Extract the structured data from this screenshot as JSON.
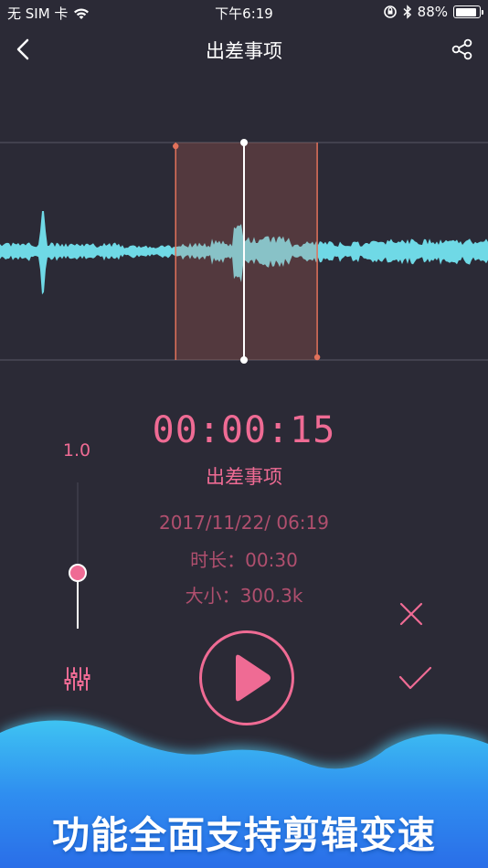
{
  "status_bar": {
    "carrier": "无 SIM 卡",
    "time": "下午6:19",
    "battery_text": "88%",
    "battery_level": 0.88
  },
  "nav": {
    "title": "出差事项",
    "back_icon": "chevron-left-icon",
    "share_icon": "share-icon"
  },
  "player": {
    "timer": "00:00:15",
    "name": "出差事项",
    "date": "2017/11/22/ 06:19",
    "duration": "时长：00:30",
    "size": "大小：300.3k"
  },
  "speed": {
    "value_label": "1.0",
    "level": 0.38
  },
  "selection": {
    "start_fraction": 0.36,
    "end_fraction": 0.65,
    "playhead_fraction": 0.5
  },
  "actions": {
    "cancel_icon": "close-icon",
    "confirm_icon": "check-icon",
    "play_icon": "play-icon",
    "eq_icon": "equalizer-icon"
  },
  "banner": {
    "text": "功能全面支持剪辑变速"
  },
  "colors": {
    "accent": "#ef6b94",
    "wave": "#6fd9e6",
    "background": "#2b2a36",
    "selection": "#e2725b"
  }
}
